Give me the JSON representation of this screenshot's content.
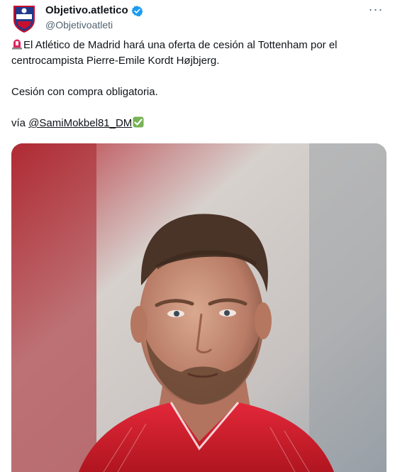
{
  "account": {
    "display_name": "Objetivo.atletico",
    "handle": "@Objetivoatleti",
    "avatar_icon": "objetivo-atletico-crest",
    "verified_icon": "verified-badge-icon",
    "verified_color": "#1d9bf0"
  },
  "menu": {
    "more_label": "···"
  },
  "tweet": {
    "line1": "El Atlético de Madrid hará una oferta de cesión al Tottenham por el centrocampista Pierre-Emile Kordt Højbjerg.",
    "line2": "Cesión con compra obligatoria.",
    "via_prefix": "vía ",
    "mention": "@SamiMokbel81_DM",
    "siren_icon": "police-light-emoji",
    "check_icon": "check-mark-button-emoji"
  },
  "media": {
    "photo_subject": "player-portrait-photo"
  },
  "colors": {
    "text": "#0f1419",
    "secondary": "#536471",
    "accent": "#1d9bf0"
  }
}
